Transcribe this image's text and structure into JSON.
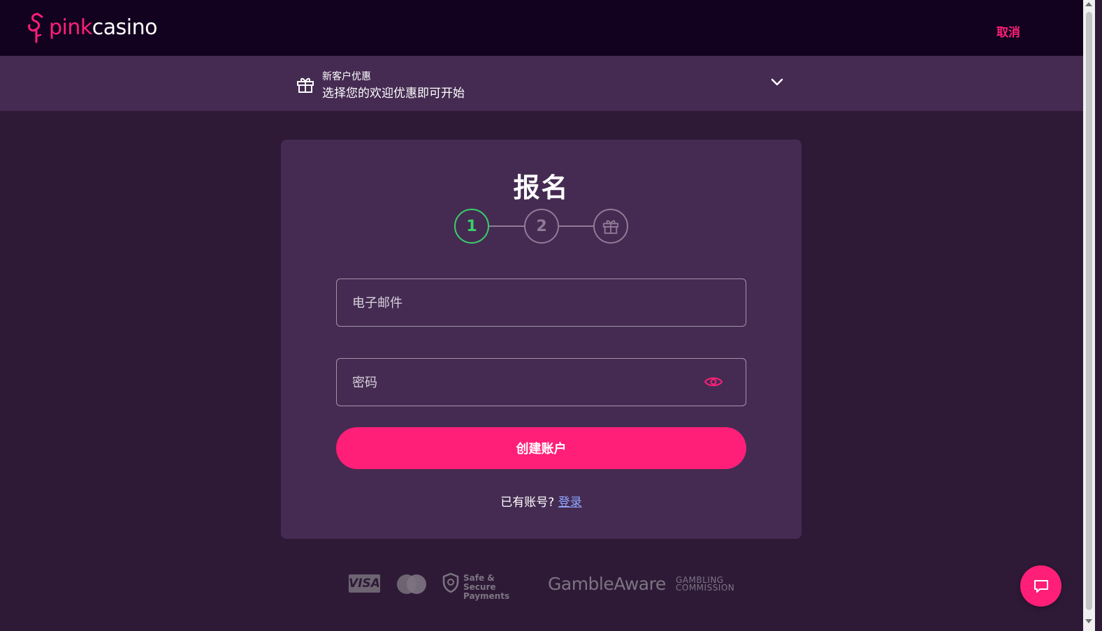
{
  "header": {
    "logo_pink": "pink",
    "logo_white": "casino",
    "cancel_label": "取消"
  },
  "promo": {
    "title": "新客户优惠",
    "subtitle": "选择您的欢迎优惠即可开始",
    "icon": "gift-icon",
    "toggle_icon": "chevron-down-icon"
  },
  "signup": {
    "title": "报名",
    "steps": [
      "1",
      "2"
    ],
    "final_step_icon": "gift-icon",
    "email_placeholder": "电子邮件",
    "password_placeholder": "密码",
    "password_toggle_icon": "eye-icon",
    "create_button": "创建账户",
    "have_account": "已有账号?",
    "login_link": "登录"
  },
  "footer": {
    "visa": "VISA",
    "secure_line1": "Safe & Secure",
    "secure_line2": "Payments",
    "gamble_aware": "GambleAware",
    "commission_line1": "GAMBLING",
    "commission_line2": "COMMISSION"
  },
  "colors": {
    "accent": "#ff1f78",
    "header_bg": "#12021f",
    "page_bg": "#2e1a37",
    "card_bg": "#452b52",
    "active_step": "#3ad06a"
  }
}
